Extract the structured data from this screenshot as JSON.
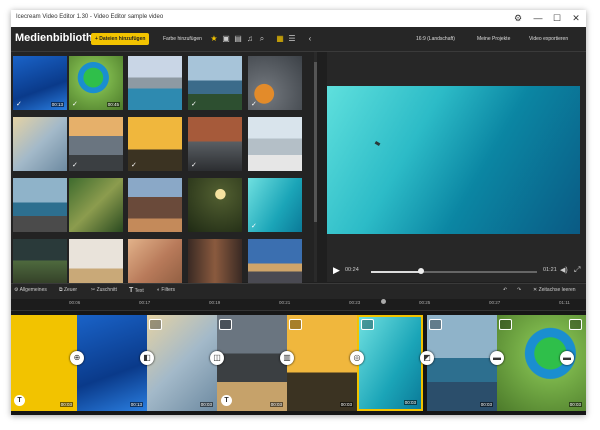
{
  "window": {
    "title": "Icecream Video Editor 1.30 - Video Editor sample video",
    "controls": [
      "⚙",
      "—",
      "☐",
      "✕"
    ]
  },
  "toolbar": {
    "media_library": "Medienbibliothek",
    "add_files": "+ Dateien hinzufügen",
    "add_folder": "Farbe hinzufügen",
    "aspect": "16:9 (Landschaft)",
    "my_projects": "Meine Projekte",
    "export": "Video exportieren",
    "filter_icons": [
      "★",
      "▣",
      "▤",
      "♫",
      "⌕"
    ],
    "view_icons": [
      "▦",
      "☰"
    ],
    "collapse": "‹"
  },
  "media": [
    {
      "dur": "00:13",
      "checked": true
    },
    {
      "dur": "00:45",
      "checked": true
    },
    {
      "dur": "",
      "checked": false
    },
    {
      "dur": "",
      "checked": true
    },
    {
      "dur": "",
      "checked": true
    },
    {
      "dur": "",
      "checked": false
    },
    {
      "dur": "",
      "checked": true
    },
    {
      "dur": "",
      "checked": true
    },
    {
      "dur": "",
      "checked": true
    },
    {
      "dur": "",
      "checked": false
    },
    {
      "dur": "",
      "checked": false
    },
    {
      "dur": "",
      "checked": false
    },
    {
      "dur": "",
      "checked": false
    },
    {
      "dur": "",
      "checked": false
    },
    {
      "dur": "",
      "checked": true
    },
    {
      "dur": "",
      "checked": false
    },
    {
      "dur": "",
      "checked": false
    },
    {
      "dur": "",
      "checked": false
    },
    {
      "dur": "",
      "checked": false
    },
    {
      "dur": "",
      "checked": false
    }
  ],
  "player": {
    "current": "00:24",
    "total": "01:21",
    "progress": 0.3
  },
  "edit_tools": {
    "general": "Allgemeines",
    "crop": "Zeuer",
    "cut": "Zuschnitt",
    "text": "Text",
    "filter": "Filters",
    "zoom_out": "Zeitachse leeren"
  },
  "ruler": [
    "00:06",
    "00:17",
    "00:19",
    "00:21",
    "00:23",
    "00:25",
    "00:27",
    "01:11"
  ],
  "clips": [
    {
      "dur": "00:03"
    },
    {
      "dur": "00:13"
    },
    {
      "dur": "00:03"
    },
    {
      "dur": "00:03"
    },
    {
      "dur": "00:03"
    },
    {
      "dur": "00:03"
    },
    {
      "dur": "00:03"
    },
    {
      "dur": "00:03"
    }
  ]
}
